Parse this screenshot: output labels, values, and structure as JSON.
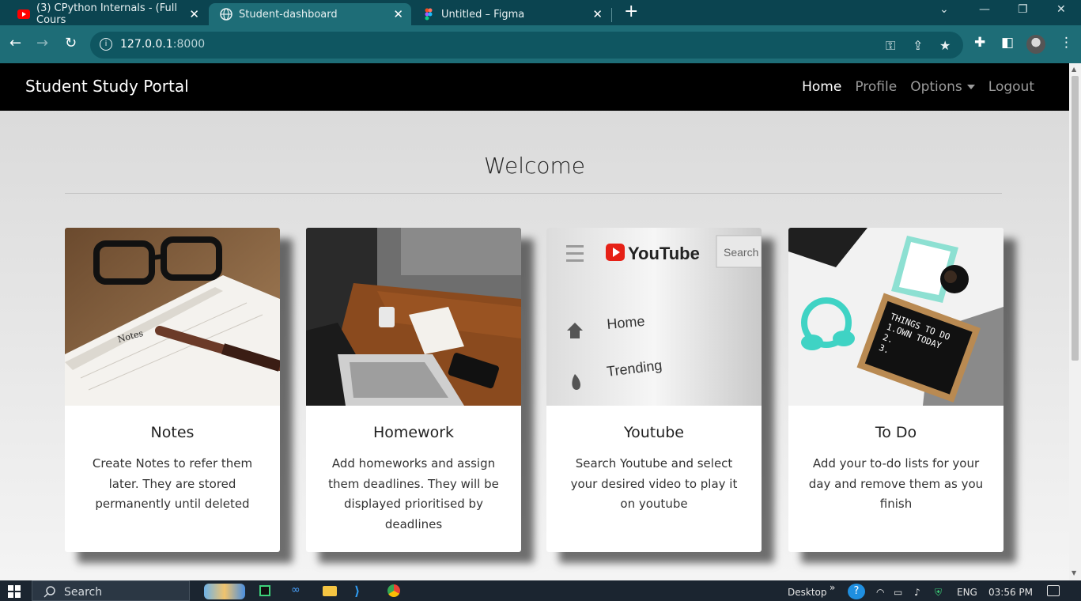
{
  "browser": {
    "tabs": [
      {
        "title": "(3) CPython Internals - (Full Cours",
        "icon": "youtube-icon"
      },
      {
        "title": "Student-dashboard",
        "icon": "globe-icon"
      },
      {
        "title": "Untitled – Figma",
        "icon": "figma-icon"
      }
    ],
    "close_glyph": "✕",
    "new_tab_glyph": "+",
    "url_host": "127.0.0.1",
    "url_port": ":8000"
  },
  "navbar": {
    "brand": "Student Study Portal",
    "links": {
      "home": "Home",
      "profile": "Profile",
      "options": "Options",
      "logout": "Logout"
    }
  },
  "main": {
    "heading": "Welcome",
    "cards": [
      {
        "title": "Notes",
        "description": "Create Notes to refer them later. They are stored permanently until deleted"
      },
      {
        "title": "Homework",
        "description": "Add homeworks and assign them deadlines. They will be displayed prioritised by deadlines"
      },
      {
        "title": "Youtube",
        "description": "Search Youtube and select your desired video to play it on youtube"
      },
      {
        "title": "To Do",
        "description": "Add your to-do lists for your day and remove them as you finish"
      }
    ],
    "card_images": {
      "notes": {
        "caption": "Notes"
      },
      "youtube": {
        "logo": "YouTube",
        "search": "Search",
        "home": "Home",
        "trending": "Trending"
      },
      "todo": {
        "line1": "THINGS TO DO",
        "line2": "1.OWN TODAY",
        "line3": "2.",
        "line4": "3."
      }
    }
  },
  "taskbar": {
    "search_label": "Search",
    "desktop_label": "Desktop",
    "language": "ENG",
    "time": "03:56 PM"
  },
  "colors": {
    "tab_strip": "#0b4450",
    "toolbar": "#1e6d77",
    "navbar": "#000000",
    "card_bg": "#ffffff"
  }
}
